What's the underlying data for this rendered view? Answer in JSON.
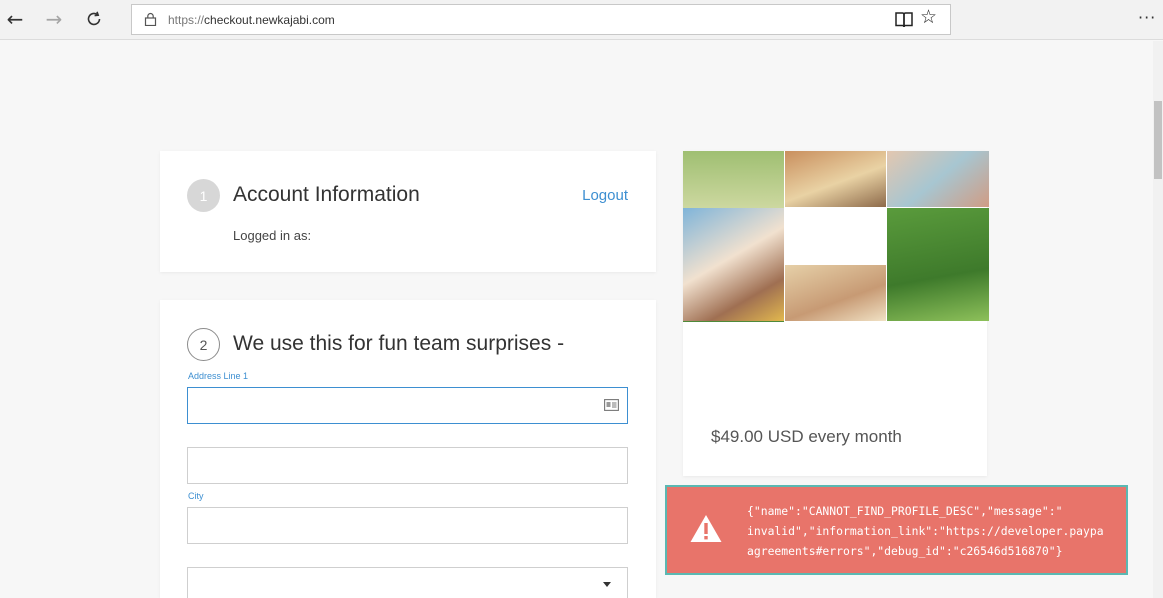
{
  "browser": {
    "url_prefix": "https://",
    "url_host": "checkout.newkajabi.com"
  },
  "account": {
    "step": "1",
    "title": "Account Information",
    "logout_label": "Logout",
    "logged_in_label": "Logged in as:"
  },
  "address": {
    "step": "2",
    "title": "We use this for fun team surprises -",
    "address_line_1_label": "Address Line 1",
    "city_label": "City"
  },
  "product": {
    "price": "$49.00 USD every month"
  },
  "error_toast": {
    "line1": "{\"name\":\"CANNOT_FIND_PROFILE_DESC\",\"message\":\"",
    "line2": "invalid\",\"information_link\":\"https://developer.paypa",
    "line3": "agreements#errors\",\"debug_id\":\"c26546d516870\"}"
  },
  "colors": {
    "accent": "#3d8fd1",
    "error": "#e8746a",
    "toast_border": "#5bb8b2"
  }
}
